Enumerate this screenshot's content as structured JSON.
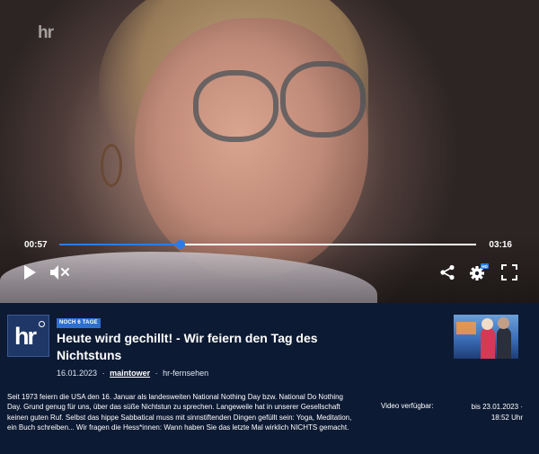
{
  "player": {
    "watermark": "hr",
    "current_time": "00:57",
    "duration": "03:16",
    "progress": 0.29,
    "colors": {
      "accent": "#2d7be8",
      "track": "#ffffff"
    },
    "icons": [
      "play-icon",
      "mute-icon",
      "share-icon",
      "settings-icon",
      "fullscreen-icon"
    ],
    "settings_badge": "HD"
  },
  "info": {
    "channel_logo": "hr",
    "badge": "NOCH 6 TAGE",
    "title": "Heute wird gechillt! - Wir feiern den Tag des Nichtstuns",
    "date": "16.01.2023",
    "sep1": "·",
    "show": "maintower",
    "sep2": "·",
    "broadcaster": "hr-fernsehen",
    "description": "Seit 1973 feiern die USA den 16. Januar als landesweiten National Nothing Day bzw. National Do Nothing Day. Grund genug für uns, über das süße Nichtstun zu sprechen. Langeweile hat in unserer Gesellschaft keinen guten Ruf. Selbst das hippe Sabbatical muss mit sinnstiftenden Dingen gefüllt sein: Yoga, Meditation, ein Buch schreiben... Wir fragen die Hess*innen: Wann haben Sie das letzte Mal wirklich NICHTS gemacht.",
    "availability_label": "Video verfügbar:",
    "availability_until": "bis 23.01.2023 ·",
    "availability_time": "18:52 Uhr",
    "colors": {
      "background": "#0d1a33",
      "badge": "#2d6fd1"
    }
  }
}
